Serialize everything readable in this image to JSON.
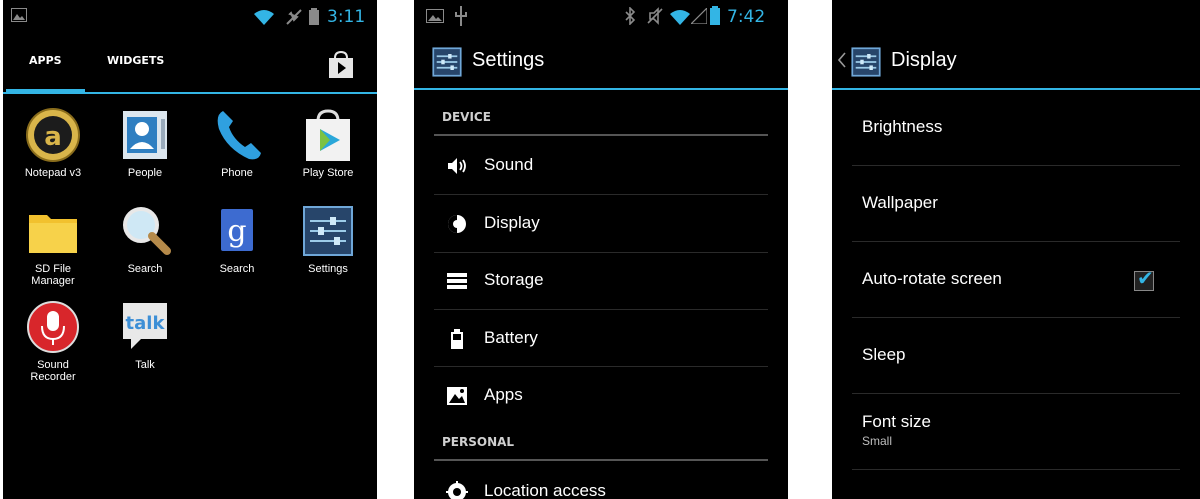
{
  "colors": {
    "accent": "#33b5e5",
    "background": "#000000",
    "text": "#ffffff"
  },
  "screen1": {
    "status": {
      "time": "3:11",
      "icons": [
        "picture-icon",
        "wifi-icon",
        "airplane-icon",
        "battery-icon"
      ]
    },
    "tabs": [
      "APPS",
      "WIDGETS"
    ],
    "store_icon": "play-store-bag-icon",
    "apps": [
      {
        "label": "Notepad v3",
        "icon": "notepad-icon"
      },
      {
        "label": "People",
        "icon": "people-icon"
      },
      {
        "label": "Phone",
        "icon": "phone-icon"
      },
      {
        "label": "Play Store",
        "icon": "play-store-icon"
      },
      {
        "label": "SD File\nManager",
        "icon": "folder-icon"
      },
      {
        "label": "Search",
        "icon": "magnifier-icon"
      },
      {
        "label": "Search",
        "icon": "google-search-icon"
      },
      {
        "label": "Settings",
        "icon": "settings-icon"
      },
      {
        "label": "Sound\nRecorder",
        "icon": "microphone-icon"
      },
      {
        "label": "Talk",
        "icon": "talk-icon"
      }
    ]
  },
  "screen2": {
    "status": {
      "time": "7:42",
      "icons": [
        "picture-icon",
        "usb-icon",
        "bluetooth-icon",
        "mute-icon",
        "wifi-icon",
        "signal-icon",
        "battery-icon"
      ]
    },
    "title": "Settings",
    "section_device": "DEVICE",
    "items": [
      {
        "label": "Sound",
        "icon": "sound-icon"
      },
      {
        "label": "Display",
        "icon": "display-icon"
      },
      {
        "label": "Storage",
        "icon": "storage-icon"
      },
      {
        "label": "Battery",
        "icon": "battery-icon"
      },
      {
        "label": "Apps",
        "icon": "apps-icon"
      }
    ],
    "section_personal": "PERSONAL",
    "personal_items": [
      {
        "label": "Location access",
        "icon": "location-icon"
      }
    ]
  },
  "screen3": {
    "title": "Display",
    "items": [
      {
        "label": "Brightness"
      },
      {
        "label": "Wallpaper"
      },
      {
        "label": "Auto-rotate screen",
        "checked": true
      },
      {
        "label": "Sleep"
      },
      {
        "label": "Font size",
        "summary": "Small"
      }
    ]
  }
}
